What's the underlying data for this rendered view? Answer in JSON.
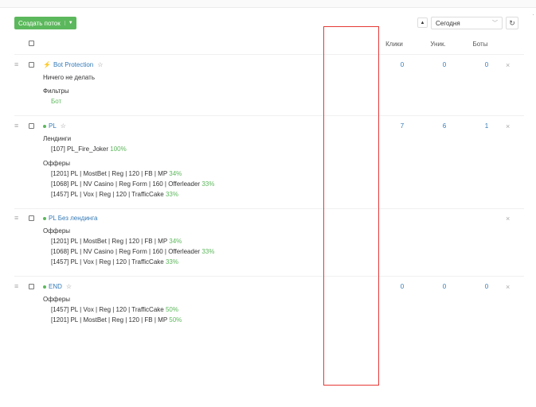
{
  "toolbar": {
    "create_label": "Создать поток",
    "period_value": "Сегодня"
  },
  "columns": {
    "clicks": "Клики",
    "unique": "Уник.",
    "bots": "Боты"
  },
  "streams": [
    {
      "name": "Bot Protection",
      "action": "Ничего не делать",
      "filters_label": "Фильтры",
      "filter_value": "Бот",
      "clicks": "0",
      "unique": "0",
      "bots": "0"
    },
    {
      "name": "PL",
      "landings_label": "Лендинги",
      "landings": [
        {
          "name": "[107] PL_Fire_Joker",
          "pct": "100%"
        }
      ],
      "offers_label": "Офферы",
      "offers": [
        {
          "name": "[1201] PL | MostBet | Reg | 120 | FB | MP",
          "pct": "34%"
        },
        {
          "name": "[1068] PL | NV Casino | Reg Form | 160 | Offerleader",
          "pct": "33%"
        },
        {
          "name": "[1457] PL | Vox | Reg | 120 | TrafficCake",
          "pct": "33%"
        }
      ],
      "clicks": "7",
      "unique": "6",
      "bots": "1"
    },
    {
      "name": "PL Без лендинга",
      "offers_label": "Офферы",
      "offers": [
        {
          "name": "[1201] PL | MostBet | Reg | 120 | FB | MP",
          "pct": "34%"
        },
        {
          "name": "[1068] PL | NV Casino | Reg Form | 160 | Offerleader",
          "pct": "33%"
        },
        {
          "name": "[1457] PL | Vox | Reg | 120 | TrafficCake",
          "pct": "33%"
        }
      ]
    },
    {
      "name": "END",
      "offers_label": "Офферы",
      "offers": [
        {
          "name": "[1457] PL | Vox | Reg | 120 | TrafficCake",
          "pct": "50%"
        },
        {
          "name": "[1201] PL | MostBet | Reg | 120 | FB | MP",
          "pct": "50%"
        }
      ],
      "clicks": "0",
      "unique": "0",
      "bots": "0"
    }
  ],
  "icons": {
    "sort": "triangle-up-icon",
    "refresh": "refresh-icon",
    "drag": "drag-handle-icon",
    "close": "close-icon",
    "star": "star-icon",
    "bolt": "bolt-icon",
    "status": "status-dot-icon"
  },
  "colors": {
    "accent": "#5cb85c",
    "link": "#337ab7",
    "highlight": "#e53935"
  }
}
